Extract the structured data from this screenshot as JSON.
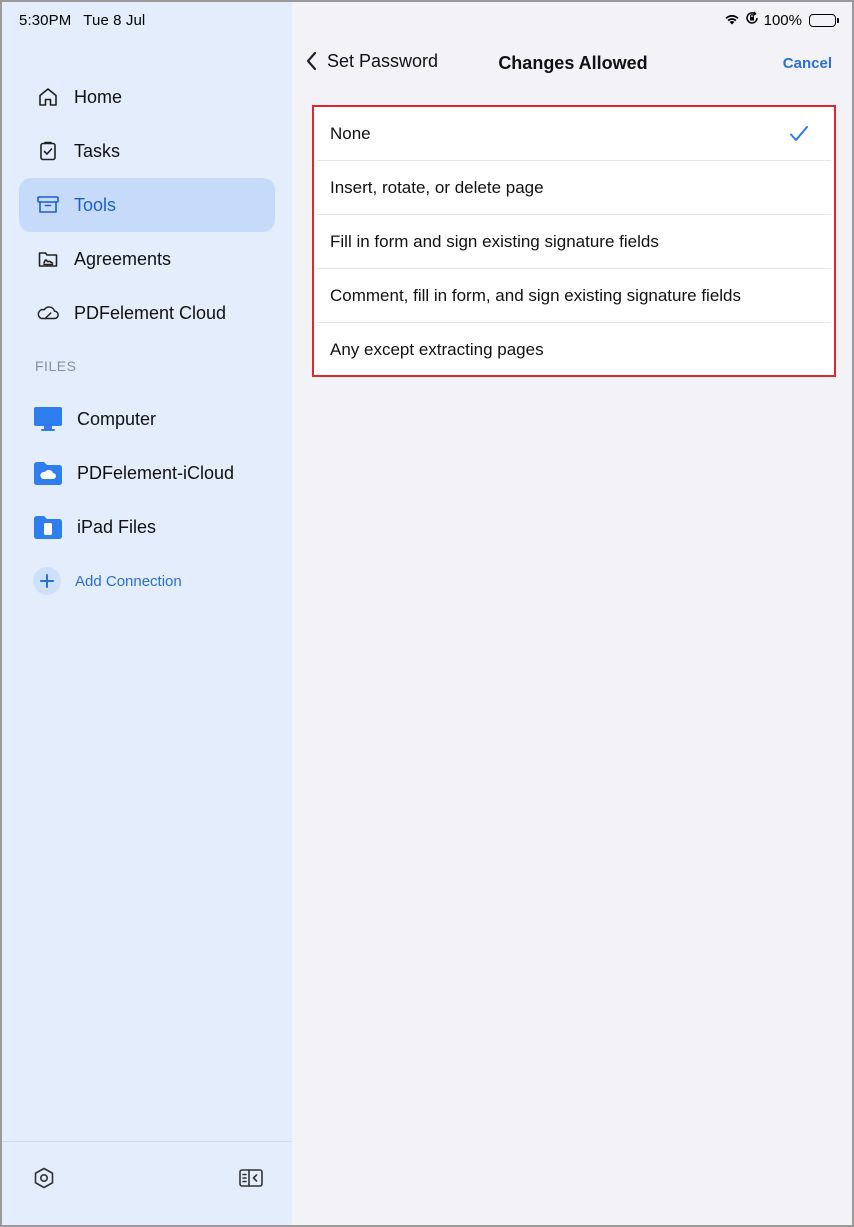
{
  "status_bar": {
    "time": "5:30PM",
    "date": "Tue 8 Jul",
    "battery_percent": "100%"
  },
  "sidebar": {
    "nav_items": [
      {
        "label": "Home",
        "icon": "home-icon"
      },
      {
        "label": "Tasks",
        "icon": "tasks-icon"
      },
      {
        "label": "Tools",
        "icon": "tools-icon",
        "active": true
      },
      {
        "label": "Agreements",
        "icon": "agreements-icon"
      },
      {
        "label": "PDFelement Cloud",
        "icon": "cloud-icon"
      }
    ],
    "files_header": "FILES",
    "files": [
      {
        "label": "Computer",
        "icon": "computer-icon"
      },
      {
        "label": "PDFelement-iCloud",
        "icon": "icloud-folder-icon"
      },
      {
        "label": "iPad Files",
        "icon": "ipad-folder-icon"
      }
    ],
    "add_connection": "Add Connection"
  },
  "navbar": {
    "back_label": "Set Password",
    "title": "Changes Allowed",
    "cancel_label": "Cancel"
  },
  "options": [
    {
      "label": "None",
      "selected": true
    },
    {
      "label": "Insert, rotate, or delete page",
      "selected": false
    },
    {
      "label": "Fill in form and sign existing signature fields",
      "selected": false
    },
    {
      "label": "Comment, fill in form, and sign existing signature fields",
      "selected": false
    },
    {
      "label": "Any except extracting pages",
      "selected": false
    }
  ],
  "colors": {
    "sidebar_bg": "#e3edfc",
    "active_bg": "#c6dbfa",
    "accent": "#2a6fd6",
    "highlight_border": "#e0262e"
  }
}
